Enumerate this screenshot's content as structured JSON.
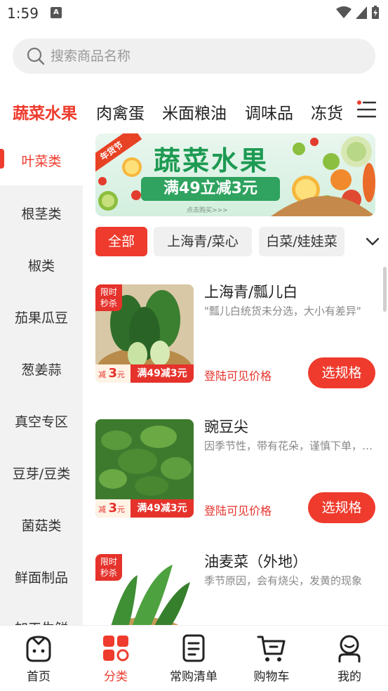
{
  "status_bar": {
    "time": "1:59"
  },
  "search": {
    "placeholder": "搜索商品名称"
  },
  "top_categories": [
    "蔬菜水果",
    "肉禽蛋",
    "米面粮油",
    "调味品",
    "冻货"
  ],
  "sidebar": {
    "items": [
      "叶菜类",
      "根茎类",
      "椒类",
      "茄果瓜豆",
      "葱姜蒜",
      "真空专区",
      "豆芽/豆类",
      "菌菇类",
      "鲜面制品",
      "加工生鲜"
    ]
  },
  "banner": {
    "tag": "年货节",
    "title": "蔬菜水果",
    "promo": "满49立减3元",
    "tap_hint": "点击购买>>>"
  },
  "filters": [
    "全部",
    "上海青/菜心",
    "白菜/娃娃菜"
  ],
  "products": [
    {
      "name": "上海青/瓢儿白",
      "desc": "\"瓢儿白统货未分选，大小有差异\"",
      "badge": "限时秒杀",
      "discount_left_prefix": "减",
      "discount_left_amount": "3",
      "discount_left_unit": "元",
      "discount_right": "满49减3元",
      "price": "登陆可见价格",
      "button": "选规格"
    },
    {
      "name": "豌豆尖",
      "desc": "因季节性，带有花朵，谨慎下单，介意慎拍",
      "badge": "",
      "discount_left_prefix": "减",
      "discount_left_amount": "3",
      "discount_left_unit": "元",
      "discount_right": "满49减3元",
      "price": "登陆可见价格",
      "button": "选规格"
    },
    {
      "name": "油麦菜（外地）",
      "desc": "季节原因，会有烧尖，发黄的现象",
      "badge": "限时秒杀"
    }
  ],
  "tabbar": {
    "items": [
      "首页",
      "分类",
      "常购清单",
      "购物车",
      "我的"
    ],
    "active": "分类"
  },
  "colors": {
    "accent": "#ee3b2d",
    "banner_green": "#1d9a52"
  }
}
